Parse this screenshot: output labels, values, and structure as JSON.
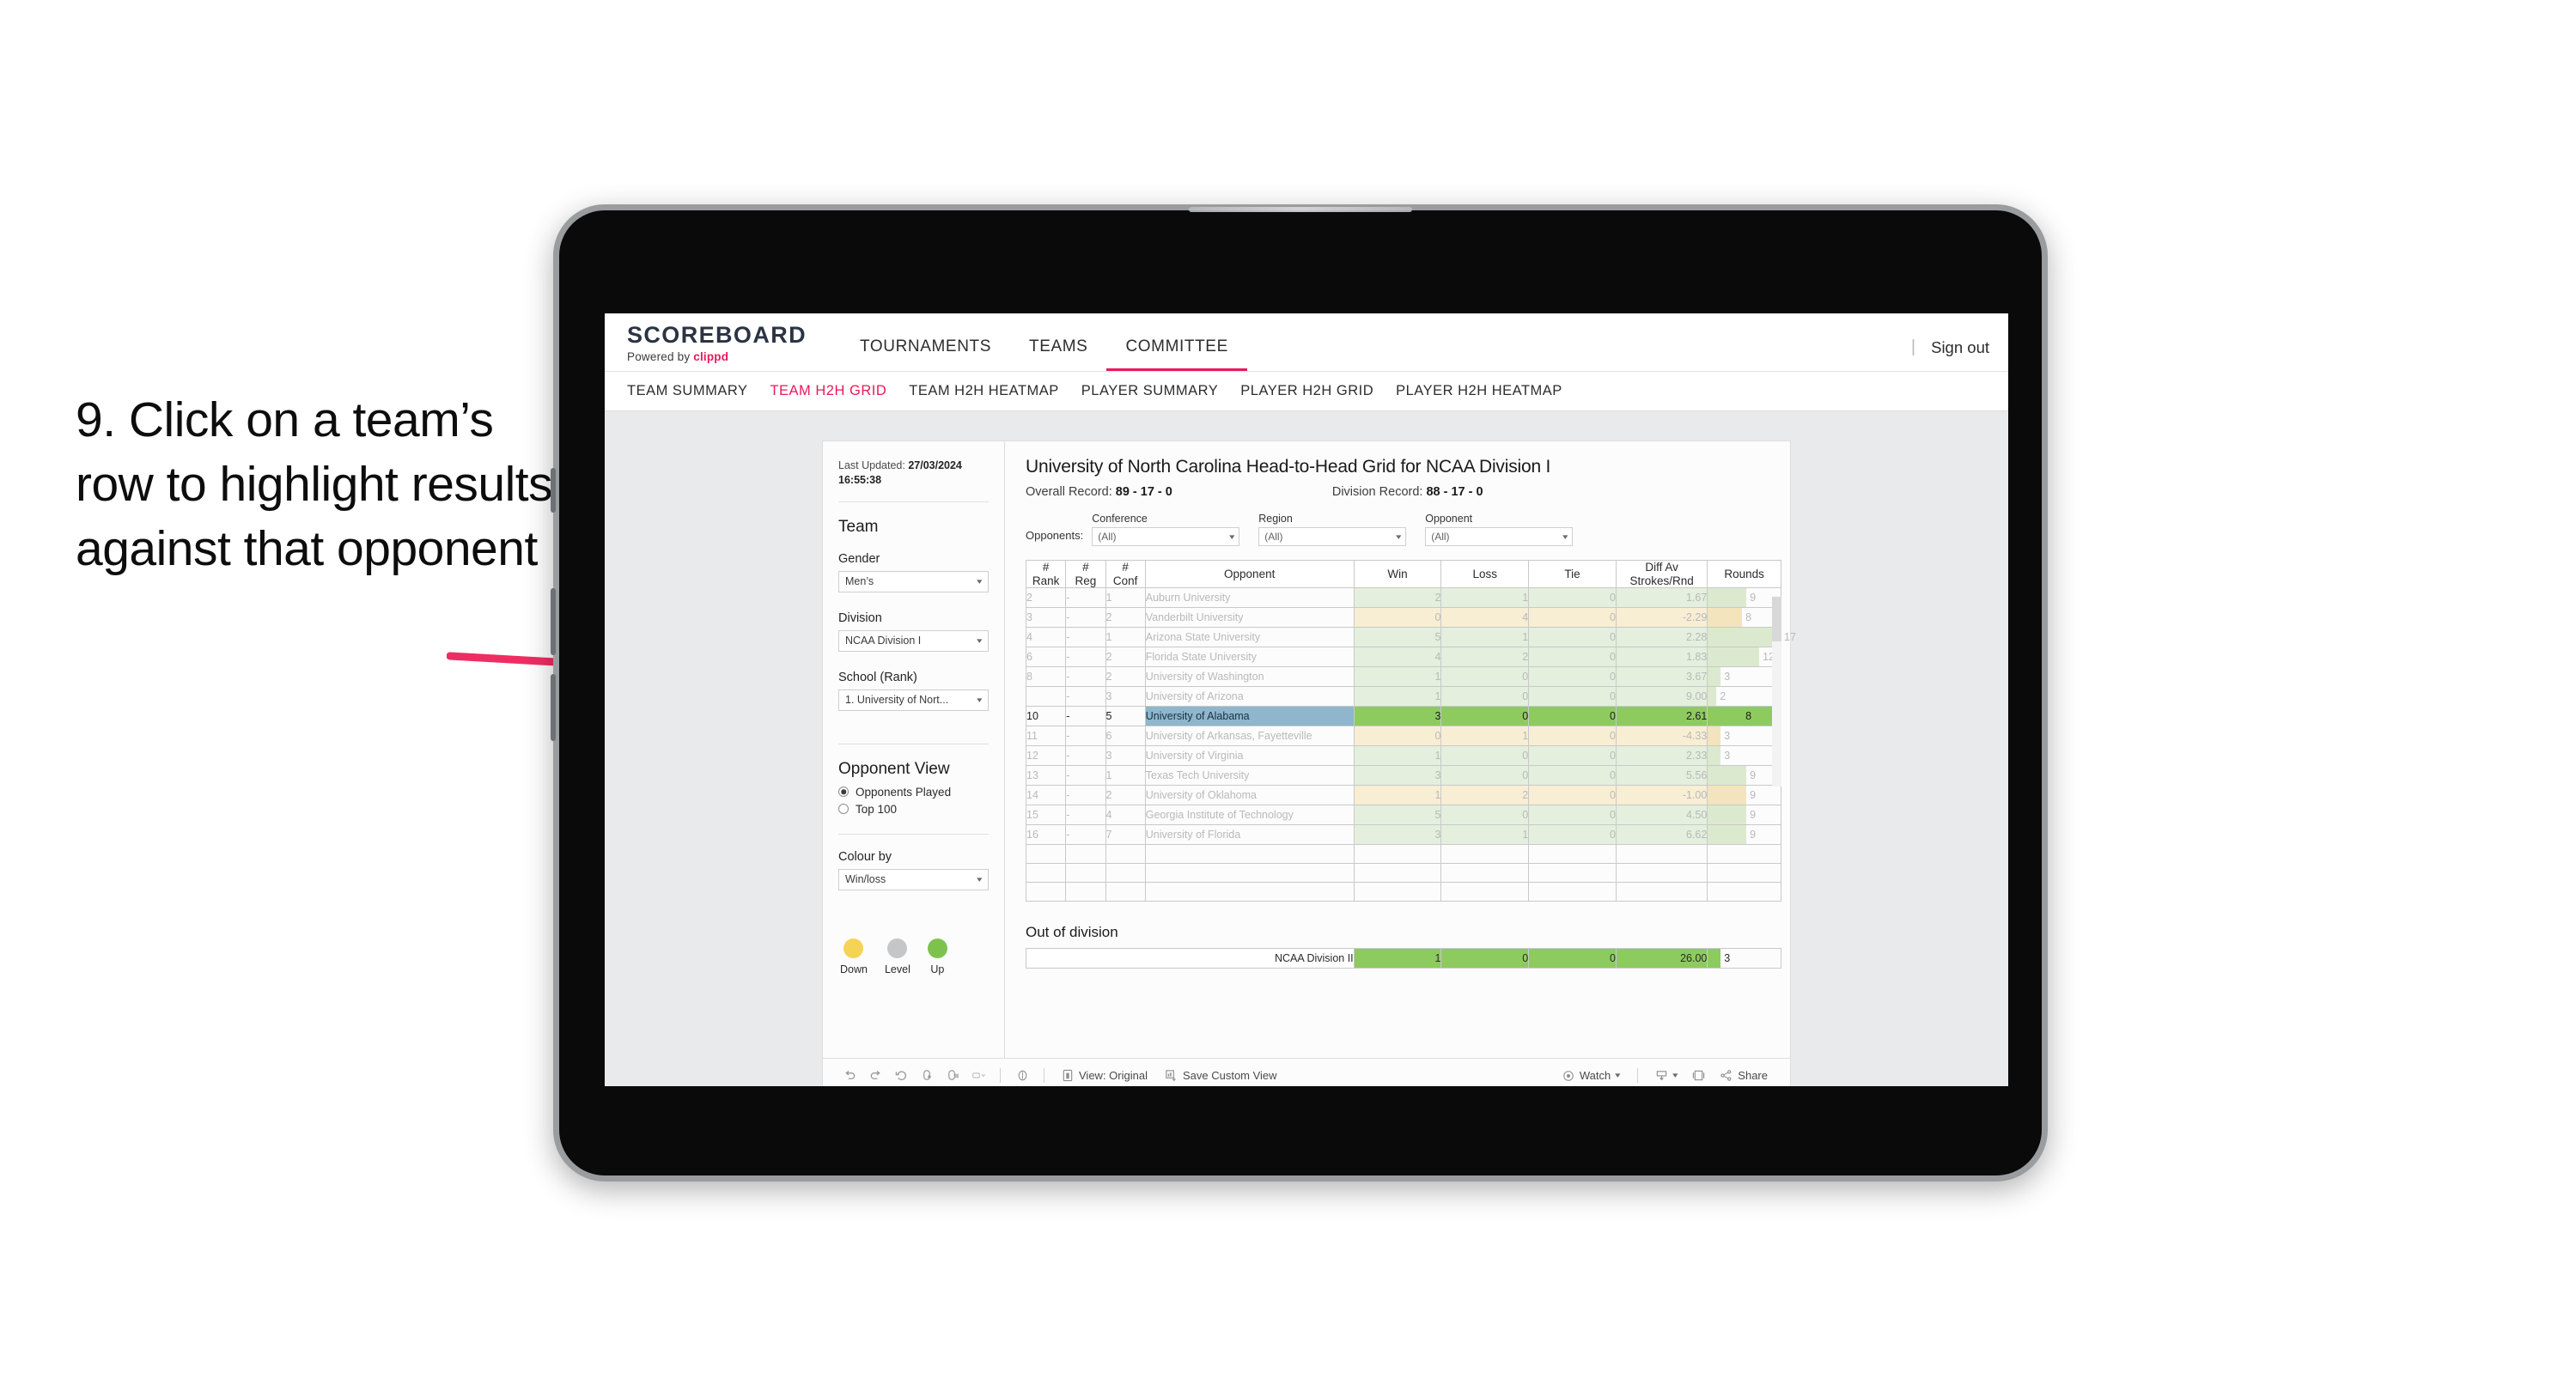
{
  "caption": {
    "text": "9. Click on a team’s row to highlight results against that opponent"
  },
  "app": {
    "brand_title": "SCOREBOARD",
    "brand_sub_prefix": "Powered by ",
    "brand_sub_accent": "clippd",
    "accent_color": "#e8195b",
    "nav": [
      {
        "label": "TOURNAMENTS",
        "active": false
      },
      {
        "label": "TEAMS",
        "active": false
      },
      {
        "label": "COMMITTEE",
        "active": true
      }
    ],
    "nav_divider": "|",
    "sign_out": "Sign out",
    "subnav": [
      {
        "label": "TEAM SUMMARY",
        "active": false
      },
      {
        "label": "TEAM H2H GRID",
        "active": true
      },
      {
        "label": "TEAM H2H HEATMAP",
        "active": false
      },
      {
        "label": "PLAYER SUMMARY",
        "active": false
      },
      {
        "label": "PLAYER H2H GRID",
        "active": false
      },
      {
        "label": "PLAYER H2H HEATMAP",
        "active": false
      }
    ]
  },
  "sidebar": {
    "last_updated_label": "Last Updated: ",
    "last_updated_value": "27/03/2024 16:55:38",
    "team_heading": "Team",
    "gender_label": "Gender",
    "gender_value": "Men’s",
    "division_label": "Division",
    "division_value": "NCAA Division I",
    "school_label": "School (Rank)",
    "school_value": "1. University of Nort...",
    "opponent_view_heading": "Opponent View",
    "radios": [
      {
        "label": "Opponents Played",
        "selected": true
      },
      {
        "label": "Top 100",
        "selected": false
      }
    ],
    "colour_by_label": "Colour by",
    "colour_by_value": "Win/loss",
    "legend": [
      {
        "label": "Down",
        "color": "#f5d354"
      },
      {
        "label": "Level",
        "color": "#c4c6c8"
      },
      {
        "label": "Up",
        "color": "#7ec24e"
      }
    ]
  },
  "main": {
    "title": "University of North Carolina Head-to-Head Grid for NCAA Division I",
    "overall_record_label": "Overall Record: ",
    "overall_record_value": "89 - 17 - 0",
    "division_record_label": "Division Record: ",
    "division_record_value": "88 - 17 - 0",
    "opponents_label": "Opponents:",
    "filters": [
      {
        "label": "Conference",
        "value": "(All)"
      },
      {
        "label": "Region",
        "value": "(All)"
      },
      {
        "label": "Opponent",
        "value": "(All)"
      }
    ],
    "out_of_division_title": "Out of division"
  },
  "chart_data": {
    "type": "table",
    "title": "University of North Carolina Head-to-Head Grid for NCAA Division I",
    "columns": [
      "# Rank",
      "# Reg",
      "# Conf",
      "Opponent",
      "Win",
      "Loss",
      "Tie",
      "Diff Av Strokes/Rnd",
      "Rounds"
    ],
    "column_headers_multiline": [
      [
        "#",
        "Rank"
      ],
      [
        "#",
        "Reg"
      ],
      [
        "#",
        "Conf"
      ],
      [
        "Opponent"
      ],
      [
        "Win"
      ],
      [
        "Loss"
      ],
      [
        "Tie"
      ],
      [
        "Diff Av",
        "Strokes/Rnd"
      ],
      [
        "Rounds"
      ]
    ],
    "rounds_max": 17,
    "rows": [
      {
        "rank": "2",
        "reg": "-",
        "conf": "1",
        "opponent": "Auburn University",
        "win": "2",
        "loss": "1",
        "tie": "0",
        "diff": "1.67",
        "rounds": "9",
        "tone": "up",
        "selected": false
      },
      {
        "rank": "3",
        "reg": "-",
        "conf": "2",
        "opponent": "Vanderbilt University",
        "win": "0",
        "loss": "4",
        "tie": "0",
        "diff": "-2.29",
        "rounds": "8",
        "tone": "down",
        "selected": false
      },
      {
        "rank": "4",
        "reg": "-",
        "conf": "1",
        "opponent": "Arizona State University",
        "win": "5",
        "loss": "1",
        "tie": "0",
        "diff": "2.28",
        "rounds": "17",
        "tone": "up",
        "selected": false
      },
      {
        "rank": "6",
        "reg": "-",
        "conf": "2",
        "opponent": "Florida State University",
        "win": "4",
        "loss": "2",
        "tie": "0",
        "diff": "1.83",
        "rounds": "12",
        "tone": "up",
        "selected": false
      },
      {
        "rank": "8",
        "reg": "-",
        "conf": "2",
        "opponent": "University of Washington",
        "win": "1",
        "loss": "0",
        "tie": "0",
        "diff": "3.67",
        "rounds": "3",
        "tone": "up",
        "selected": false
      },
      {
        "rank": "",
        "reg": "-",
        "conf": "3",
        "opponent": "University of Arizona",
        "win": "1",
        "loss": "0",
        "tie": "0",
        "diff": "9.00",
        "rounds": "2",
        "tone": "up",
        "selected": false
      },
      {
        "rank": "10",
        "reg": "-",
        "conf": "5",
        "opponent": "University of Alabama",
        "win": "3",
        "loss": "0",
        "tie": "0",
        "diff": "2.61",
        "rounds": "8",
        "tone": "up",
        "selected": true
      },
      {
        "rank": "11",
        "reg": "-",
        "conf": "6",
        "opponent": "University of Arkansas, Fayetteville",
        "win": "0",
        "loss": "1",
        "tie": "0",
        "diff": "-4.33",
        "rounds": "3",
        "tone": "down",
        "selected": false
      },
      {
        "rank": "12",
        "reg": "-",
        "conf": "3",
        "opponent": "University of Virginia",
        "win": "1",
        "loss": "0",
        "tie": "0",
        "diff": "2.33",
        "rounds": "3",
        "tone": "up",
        "selected": false
      },
      {
        "rank": "13",
        "reg": "-",
        "conf": "1",
        "opponent": "Texas Tech University",
        "win": "3",
        "loss": "0",
        "tie": "0",
        "diff": "5.56",
        "rounds": "9",
        "tone": "up",
        "selected": false
      },
      {
        "rank": "14",
        "reg": "-",
        "conf": "2",
        "opponent": "University of Oklahoma",
        "win": "1",
        "loss": "2",
        "tie": "0",
        "diff": "-1.00",
        "rounds": "9",
        "tone": "down",
        "selected": false
      },
      {
        "rank": "15",
        "reg": "-",
        "conf": "4",
        "opponent": "Georgia Institute of Technology",
        "win": "5",
        "loss": "0",
        "tie": "0",
        "diff": "4.50",
        "rounds": "9",
        "tone": "up",
        "selected": false
      },
      {
        "rank": "16",
        "reg": "-",
        "conf": "7",
        "opponent": "University of Florida",
        "win": "3",
        "loss": "1",
        "tie": "0",
        "diff": "6.62",
        "rounds": "9",
        "tone": "up",
        "selected": false
      }
    ],
    "out_of_division": {
      "label": "NCAA Division II",
      "win": "1",
      "loss": "0",
      "tie": "0",
      "diff": "26.00",
      "rounds": "3"
    }
  },
  "toolbar": {
    "view_label": "View: Original",
    "save_label": "Save Custom View",
    "watch_label": "Watch",
    "share_label": "Share"
  }
}
